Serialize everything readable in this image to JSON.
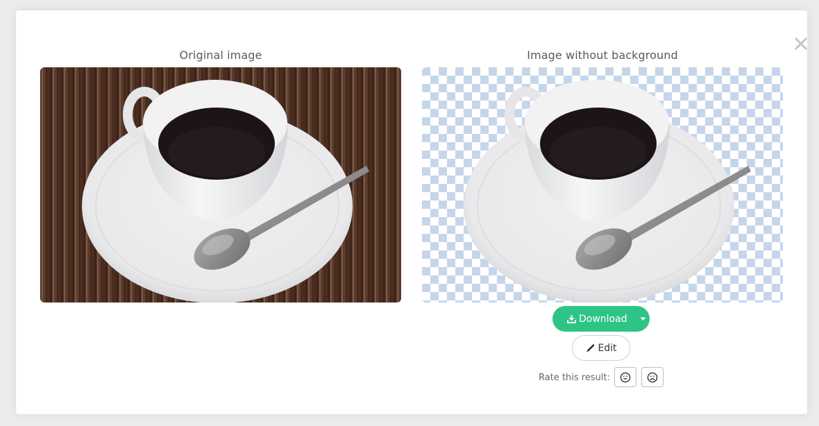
{
  "modal": {
    "original_title": "Original image",
    "result_title": "Image without background",
    "download_label": "Download",
    "edit_label": "Edit",
    "rate_label": "Rate this result:",
    "icons": {
      "close": "close-icon",
      "download": "download-icon",
      "caret": "caret-down-icon",
      "edit": "brush-icon",
      "happy": "smile-icon",
      "sad": "frown-icon"
    },
    "colors": {
      "accent": "#2ec486",
      "checker": "#c6d6ea"
    }
  }
}
